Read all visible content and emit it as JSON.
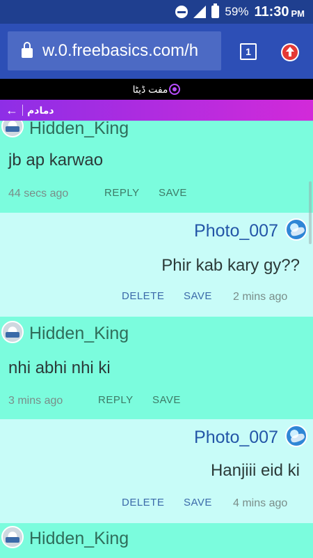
{
  "status_bar": {
    "battery": "59%",
    "time": "11:30",
    "ampm": "PM",
    "network": "H"
  },
  "browser": {
    "url": "w.0.freebasics.com/h",
    "tab_count": "1"
  },
  "freebasics": {
    "label": "مفت ڈیٹا"
  },
  "header": {
    "title": "دمادم"
  },
  "messages": [
    {
      "user": "Hidden_King",
      "text": "jb ap karwao",
      "time": "44 secs ago",
      "action1": "REPLY",
      "action2": "SAVE"
    },
    {
      "user": "Photo_007",
      "text": "Phir kab kary gy??",
      "time": "2 mins ago",
      "action1": "DELETE",
      "action2": "SAVE"
    },
    {
      "user": "Hidden_King",
      "text": "nhi abhi nhi ki",
      "time": "3 mins ago",
      "action1": "REPLY",
      "action2": "SAVE"
    },
    {
      "user": "Photo_007",
      "text": "Hanjiii eid ki",
      "time": "4 mins ago",
      "action1": "DELETE",
      "action2": "SAVE"
    },
    {
      "user": "Hidden_King"
    }
  ]
}
